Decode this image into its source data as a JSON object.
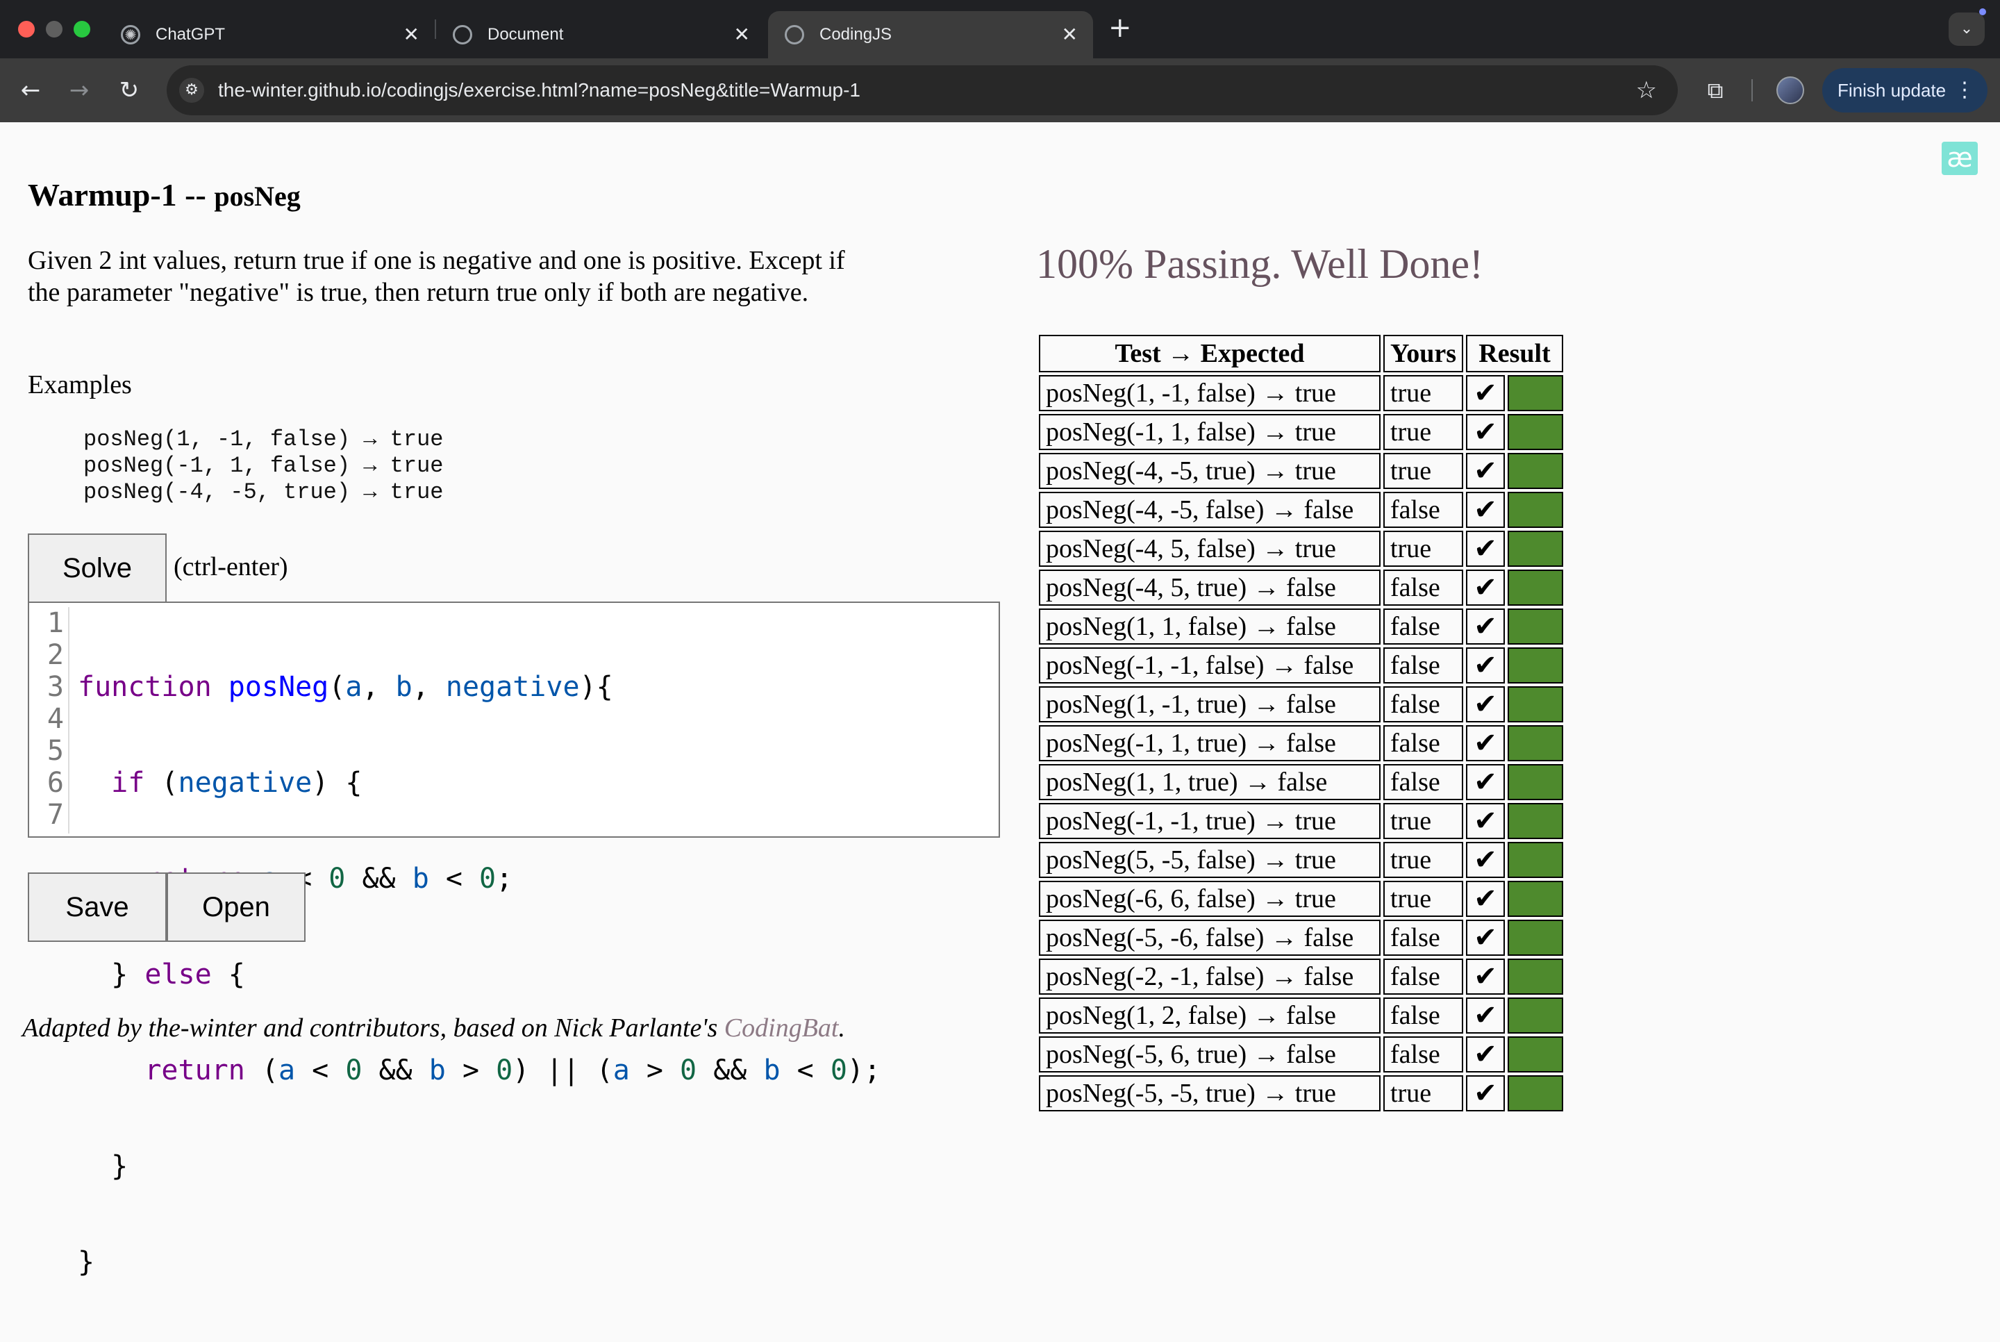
{
  "browser": {
    "tabs": [
      {
        "title": "ChatGPT",
        "icon": "openai-icon",
        "active": false
      },
      {
        "title": "Document",
        "icon": "globe-icon",
        "active": false
      },
      {
        "title": "CodingJS",
        "icon": "globe-icon",
        "active": true
      }
    ],
    "new_tab_symbol": "+",
    "url": "the-winter.github.io/codingjs/exercise.html?name=posNeg&title=Warmup-1",
    "update_button": "Finish update"
  },
  "page": {
    "title_prefix": "Warmup-1 -- ",
    "title_name": "posNeg",
    "description": "Given 2 int values, return true if one is negative and one is positive. Except if the parameter \"negative\" is true, then return true only if both are negative.",
    "examples_label": "Examples",
    "examples": [
      "posNeg(1, -1, false) → true",
      "posNeg(-1, 1, false) → true",
      "posNeg(-4, -5, true) → true"
    ],
    "solve_button": "Solve",
    "solve_hint": "(ctrl-enter)",
    "line_numbers": [
      "1",
      "2",
      "3",
      "4",
      "5",
      "6",
      "7"
    ],
    "save_button": "Save",
    "open_button": "Open",
    "footer_text": "Adapted by the-winter and contributors, based on Nick Parlante's ",
    "footer_link": "CodingBat",
    "footer_end": "."
  },
  "results": {
    "status": "100% Passing. Well Done!",
    "headers": [
      "Test → Expected",
      "Yours",
      "Result"
    ],
    "pass_color": "#4e8a2d",
    "rows": [
      {
        "test": "posNeg(1, -1, false) → true",
        "yours": "true",
        "mark": "✔"
      },
      {
        "test": "posNeg(-1, 1, false) → true",
        "yours": "true",
        "mark": "✔"
      },
      {
        "test": "posNeg(-4, -5, true) → true",
        "yours": "true",
        "mark": "✔"
      },
      {
        "test": "posNeg(-4, -5, false) → false",
        "yours": "false",
        "mark": "✔"
      },
      {
        "test": "posNeg(-4, 5, false) → true",
        "yours": "true",
        "mark": "✔"
      },
      {
        "test": "posNeg(-4, 5, true) → false",
        "yours": "false",
        "mark": "✔"
      },
      {
        "test": "posNeg(1, 1, false) → false",
        "yours": "false",
        "mark": "✔"
      },
      {
        "test": "posNeg(-1, -1, false) → false",
        "yours": "false",
        "mark": "✔"
      },
      {
        "test": "posNeg(1, -1, true) → false",
        "yours": "false",
        "mark": "✔"
      },
      {
        "test": "posNeg(-1, 1, true) → false",
        "yours": "false",
        "mark": "✔"
      },
      {
        "test": "posNeg(1, 1, true) → false",
        "yours": "false",
        "mark": "✔"
      },
      {
        "test": "posNeg(-1, -1, true) → true",
        "yours": "true",
        "mark": "✔"
      },
      {
        "test": "posNeg(5, -5, false) → true",
        "yours": "true",
        "mark": "✔"
      },
      {
        "test": "posNeg(-6, 6, false) → true",
        "yours": "true",
        "mark": "✔"
      },
      {
        "test": "posNeg(-5, -6, false) → false",
        "yours": "false",
        "mark": "✔"
      },
      {
        "test": "posNeg(-2, -1, false) → false",
        "yours": "false",
        "mark": "✔"
      },
      {
        "test": "posNeg(1, 2, false) → false",
        "yours": "false",
        "mark": "✔"
      },
      {
        "test": "posNeg(-5, 6, true) → false",
        "yours": "false",
        "mark": "✔"
      },
      {
        "test": "posNeg(-5, -5, true) → true",
        "yours": "true",
        "mark": "✔"
      }
    ]
  }
}
